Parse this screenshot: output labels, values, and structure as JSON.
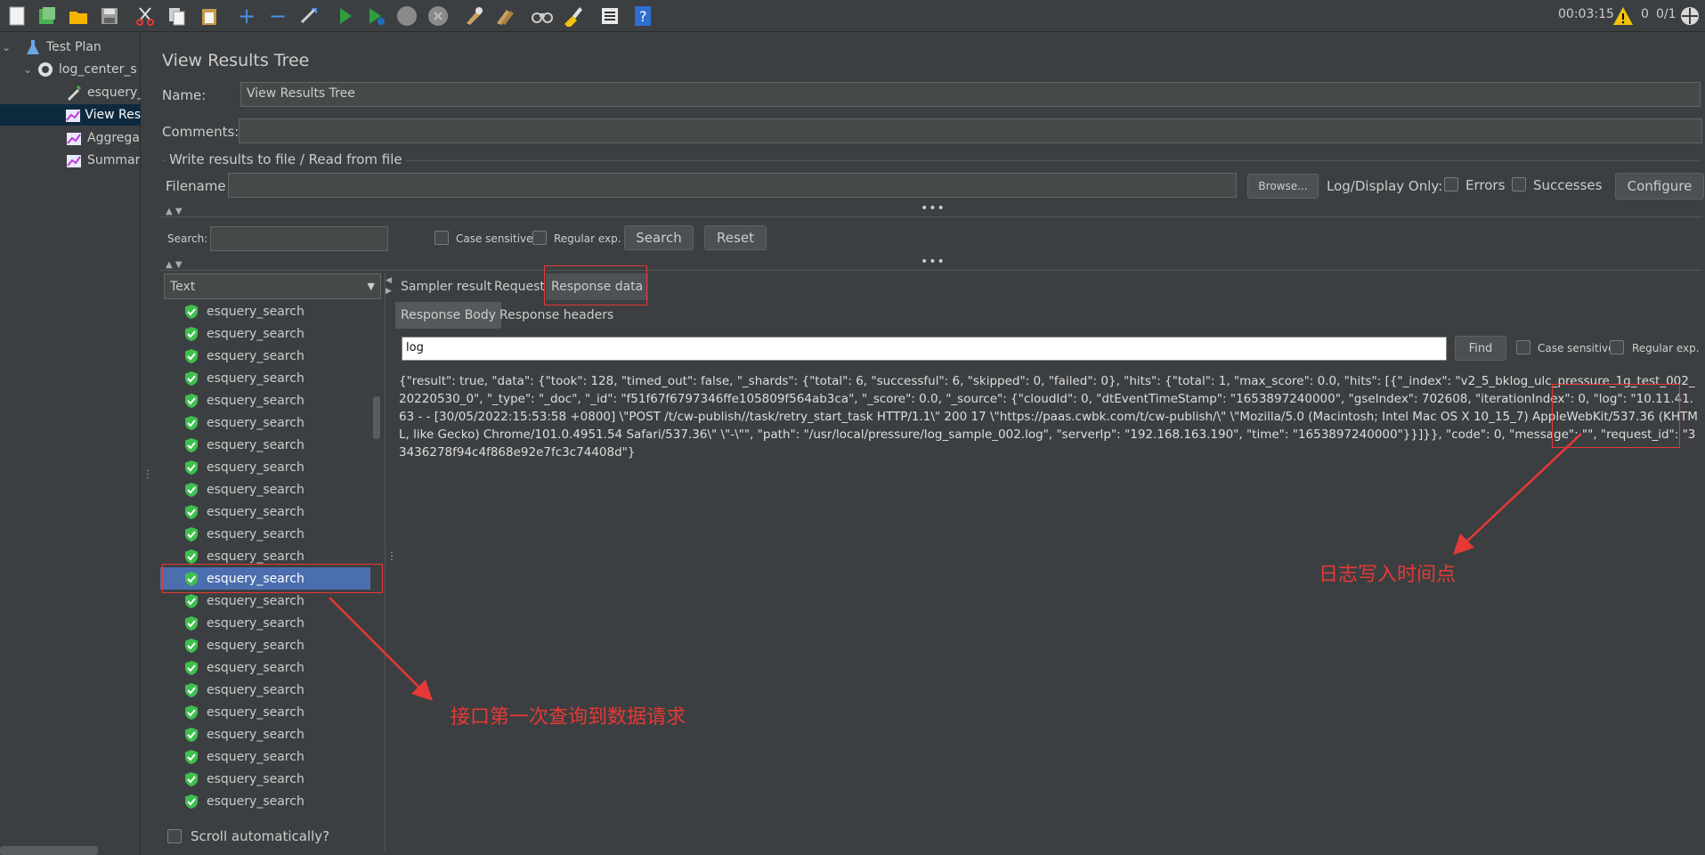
{
  "toolbar": {
    "icons": [
      "new-icon",
      "templates-icon",
      "open-icon",
      "save-icon",
      "cut-icon",
      "copy-icon",
      "paste-icon",
      "expand-icon",
      "collapse-icon",
      "toggle-icon",
      "start-icon",
      "start-no-pause-icon",
      "stop-icon",
      "shutdown-icon",
      "clear-icon",
      "clear-all-icon",
      "search-icon",
      "reset-search-icon",
      "function-helper-icon",
      "help-icon"
    ],
    "elapsed": "00:03:15",
    "warning_count": "0",
    "threads": "0/1"
  },
  "tree": {
    "items": [
      {
        "label": "Test Plan",
        "icon": "flask-icon"
      },
      {
        "label": "log_center_s",
        "icon": "gear-icon"
      },
      {
        "label": "esquery_",
        "icon": "pipette-icon"
      },
      {
        "label": "View Res",
        "icon": "chart-icon"
      },
      {
        "label": "Aggrega",
        "icon": "chart-icon"
      },
      {
        "label": "Summar",
        "icon": "chart-icon"
      }
    ]
  },
  "panel": {
    "title": "View Results Tree",
    "name_label": "Name:",
    "name_value": "View Results Tree",
    "comments_label": "Comments:",
    "comments_value": "",
    "file_section_title": "Write results to file / Read from file",
    "filename_label": "Filename",
    "filename_value": "",
    "browse_label": "Browse...",
    "log_display_label": "Log/Display Only:",
    "errors_label": "Errors",
    "successes_label": "Successes",
    "configure_label": "Configure",
    "search_label": "Search:",
    "search_value": "",
    "case_sensitive_label": "Case sensitive",
    "regular_exp_label": "Regular exp.",
    "search_button": "Search",
    "reset_button": "Reset",
    "renderer_selected": "Text",
    "scroll_auto_label": "Scroll automatically?"
  },
  "results": {
    "items": [
      "esquery_search",
      "esquery_search",
      "esquery_search",
      "esquery_search",
      "esquery_search",
      "esquery_search",
      "esquery_search",
      "esquery_search",
      "esquery_search",
      "esquery_search",
      "esquery_search",
      "esquery_search",
      "esquery_search",
      "esquery_search",
      "esquery_search",
      "esquery_search",
      "esquery_search",
      "esquery_search",
      "esquery_search",
      "esquery_search",
      "esquery_search",
      "esquery_search",
      "esquery_search"
    ]
  },
  "response": {
    "tabs": [
      "Sampler result",
      "Request",
      "Response data"
    ],
    "subtabs": [
      "Response Body",
      "Response headers"
    ],
    "find_value": "log",
    "find_button": "Find",
    "case_sensitive_label": "Case sensitive",
    "regular_exp_label": "Regular exp.",
    "body": "{\"result\": true, \"data\": {\"took\": 128, \"timed_out\": false, \"_shards\": {\"total\": 6, \"successful\": 6, \"skipped\": 0, \"failed\": 0}, \"hits\": {\"total\": 1, \"max_score\": 0.0, \"hits\": [{\"_index\": \"v2_5_bklog_ulc_pressure_1g_test_002_20220530_0\", \"_type\": \"_doc\", \"_id\": \"f51f67f6797346ffe105809f564ab3ca\", \"_score\": 0.0, \"_source\": {\"cloudId\": 0, \"dtEventTimeStamp\": \"1653897240000\", \"gseIndex\": 702608, \"iterationIndex\": 0, \"log\": \"10.11.41.63 - - [30/05/2022:15:53:58 +0800] \\\"POST /t/cw-publish//task/retry_start_task HTTP/1.1\\\" 200 17 \\\"https://paas.cwbk.com/t/cw-publish/\\\" \\\"Mozilla/5.0 (Macintosh; Intel Mac OS X 10_15_7) AppleWebKit/537.36 (KHTML, like Gecko) Chrome/101.0.4951.54 Safari/537.36\\\" \\\"-\\\"\", \"path\": \"/usr/local/pressure/log_sample_002.log\", \"serverIp\": \"192.168.163.190\", \"time\": \"1653897240000\"}}]}}, \"code\": 0, \"message\": \"\", \"request_id\": \"33436278f94c4f868e92e7fc3c74408d\"}"
  },
  "annotations": {
    "log_time": "日志写入时间点",
    "first_query": "接口第一次查询到数据请求"
  },
  "colors": {
    "annotation": "#e53935",
    "selection": "#4b6eaf",
    "shield": "#3fbf4f"
  }
}
